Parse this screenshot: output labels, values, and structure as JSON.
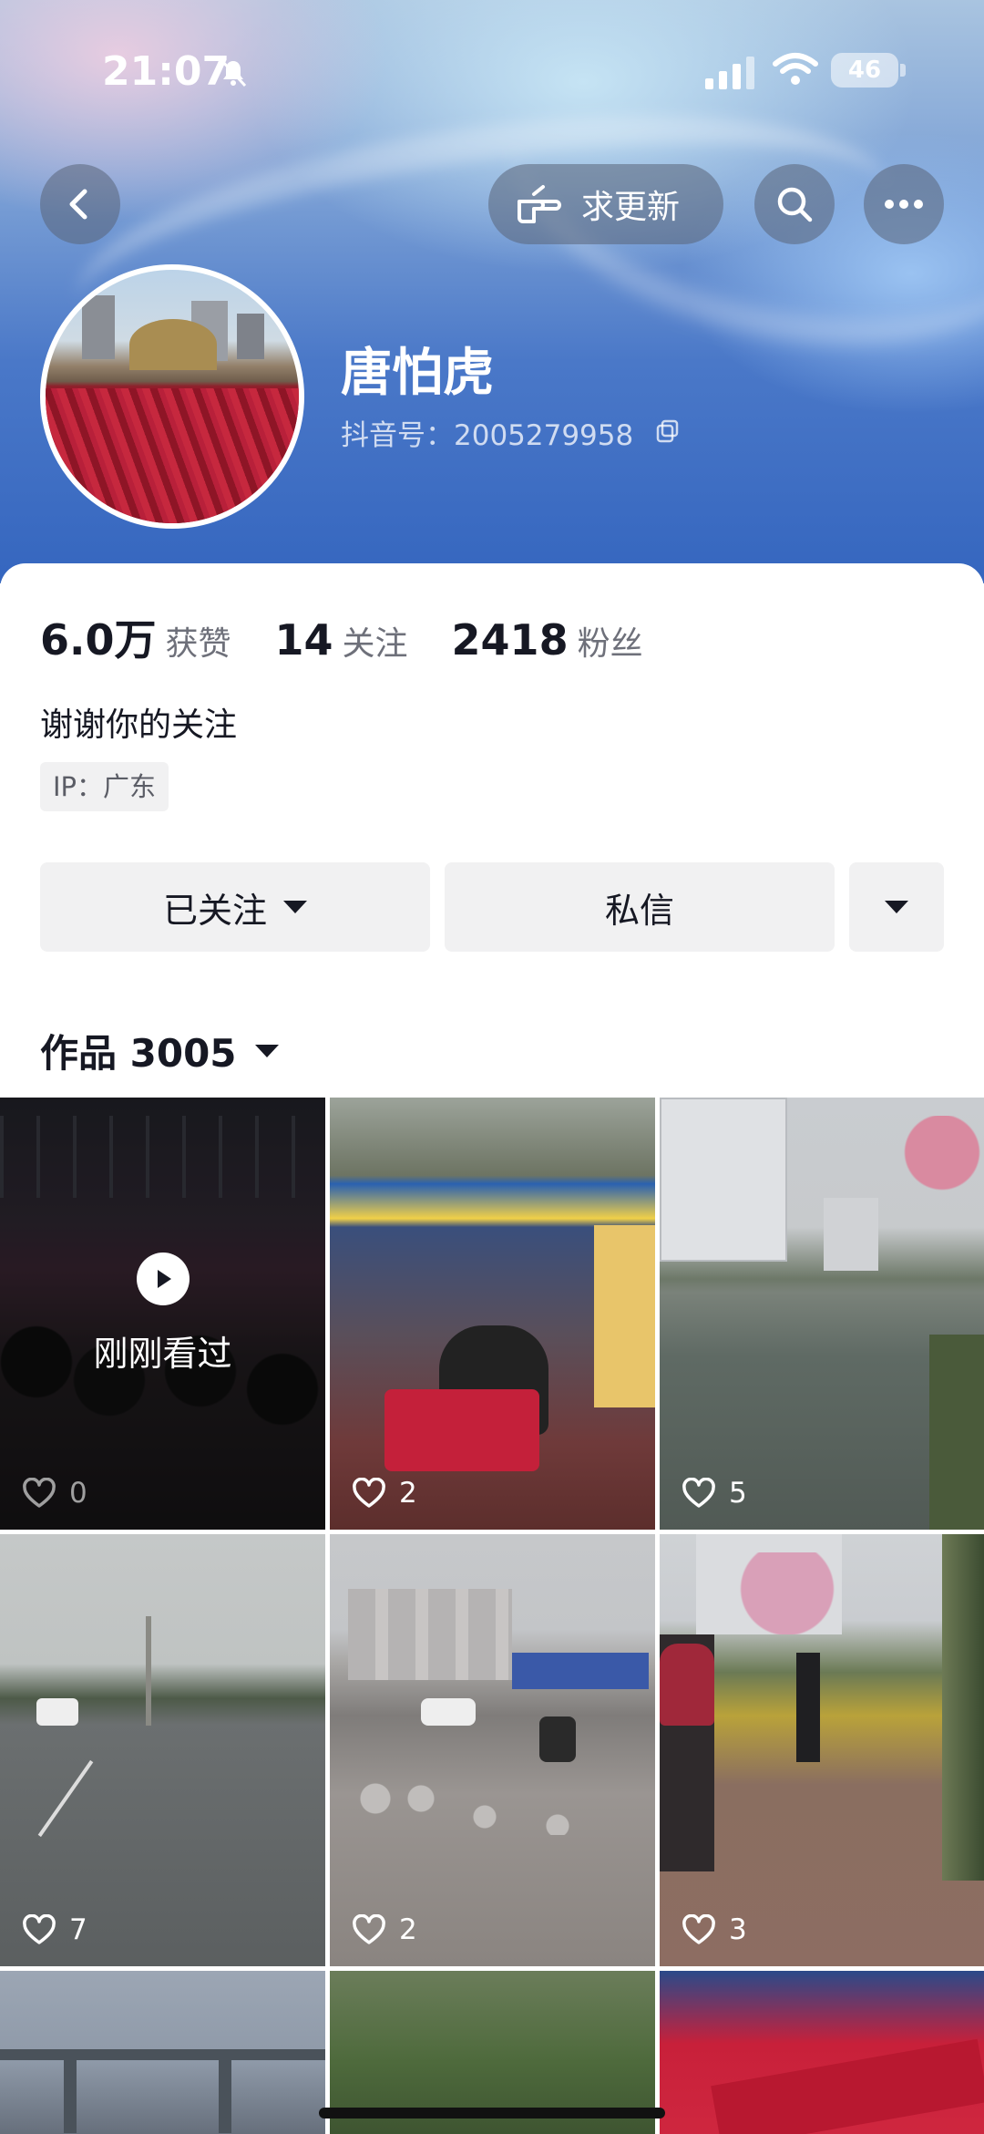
{
  "status_bar": {
    "time": "21:07",
    "battery": "46"
  },
  "header": {
    "update_label": "求更新"
  },
  "profile": {
    "name": "唐怕虎",
    "douyin_id": "抖音号：2005279958",
    "stats": [
      {
        "value": "6.0万",
        "label": "获赞"
      },
      {
        "value": "14",
        "label": "关注"
      },
      {
        "value": "2418",
        "label": "粉丝"
      }
    ],
    "bio": "谢谢你的关注",
    "ip": "IP：广东"
  },
  "actions": {
    "follow_label": "已关注",
    "message_label": "私信"
  },
  "works": {
    "label": "作品 3005"
  },
  "grid": {
    "watched_label": "刚刚看过",
    "tiles": [
      {
        "likes": "0"
      },
      {
        "likes": "2"
      },
      {
        "likes": "5"
      },
      {
        "likes": "7"
      },
      {
        "likes": "2"
      },
      {
        "likes": "3"
      }
    ]
  }
}
